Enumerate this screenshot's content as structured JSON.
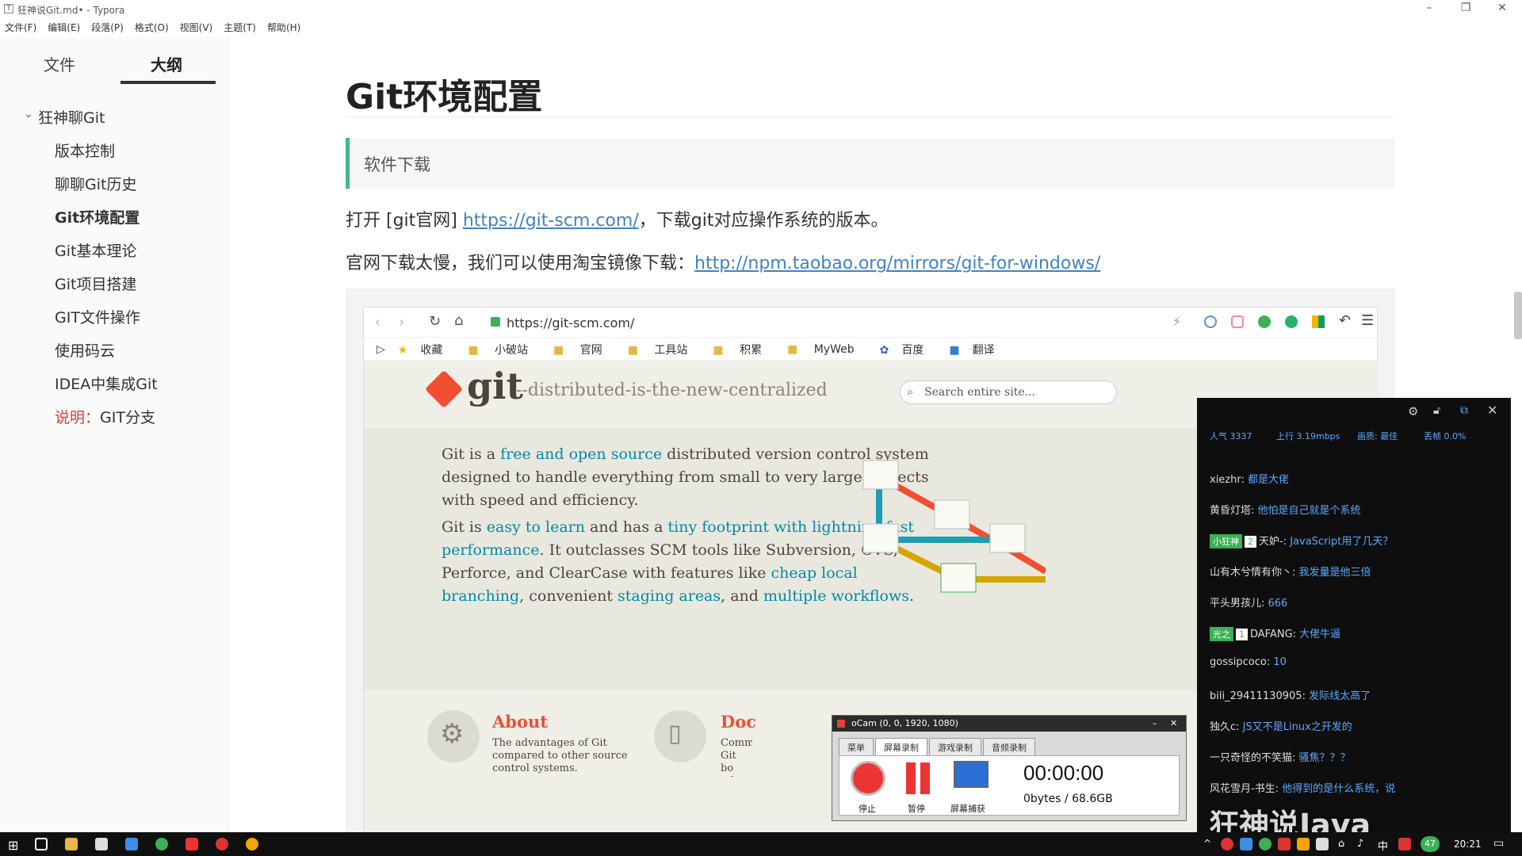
{
  "window": {
    "title": "狂神说Git.md• - Typora",
    "icon": "T"
  },
  "menu": [
    "文件(F)",
    "编辑(E)",
    "段落(P)",
    "格式(O)",
    "视图(V)",
    "主题(T)",
    "帮助(H)"
  ],
  "sidebar": {
    "tabs": [
      "文件",
      "大纲"
    ],
    "root": "狂神聊Git",
    "items": [
      "版本控制",
      "聊聊Git历史",
      "Git环境配置",
      "Git基本理论",
      "Git项目搭建",
      "GIT文件操作",
      "使用码云",
      "IDEA中集成Git"
    ],
    "note_prefix": "说明：",
    "note_label": "GIT分支",
    "footer": [
      "<",
      "</>"
    ]
  },
  "doc": {
    "heading": "Git环境配置",
    "quote": "软件下载",
    "p1_prefix": "打开 [git官网] ",
    "p1_link": "https://git-scm.com/",
    "p1_suffix": "，下载git对应操作系统的版本。",
    "p2_prefix": "官网下载太慢，我们可以使用淘宝镜像下载：",
    "p2_link": "http://npm.taobao.org/mirrors/git-for-windows/"
  },
  "browser": {
    "url": "https://git-scm.com/",
    "bookmarks": [
      "收藏",
      "小破站",
      "官网",
      "工具站",
      "积累",
      "MyWeb",
      "百度",
      "翻译"
    ],
    "git": {
      "logo": "git",
      "tagline": "--distributed-is-the-new-centralized",
      "search_placeholder": "Search entire site...",
      "para1_a": "Git is a ",
      "para1_link": "free and open source",
      "para1_b": " distributed version control system designed to handle everything from small to very large projects with speed and efficiency.",
      "para2_a": "Git is ",
      "para2_link1": "easy to learn",
      "para2_b": " and has a ",
      "para2_link2": "tiny footprint with lightning fast performance",
      "para2_c": ". It outclasses SCM tools like Subversion, CVS, Perforce, and ClearCase with features like ",
      "para2_link3": "cheap local branching",
      "para2_d": ", convenient ",
      "para2_link4": "staging areas",
      "para2_e": ", and ",
      "para2_link5": "multiple workflows",
      "para2_f": ".",
      "about_title": "About",
      "about_text": "The advantages of Git compared to other source control systems.",
      "doc_title": "Doc",
      "doc_text": "Comm Git bo other"
    }
  },
  "live": {
    "stats": {
      "popularity": "人气  3337",
      "upload": "上行  3.19mbps",
      "quality": "画质: 最佳",
      "drop": "丢帧 0.0%"
    },
    "messages": [
      {
        "user": "xiezhr: ",
        "msg": "都是大佬"
      },
      {
        "user": "黄昏灯塔: ",
        "msg": "他怕是自己就是个系统"
      },
      {
        "badge": "小狂神",
        "level": "2",
        "user": "天妒-: ",
        "msg": "JavaScript用了几天？"
      },
      {
        "user": "山有木兮情有你丶: ",
        "msg": "我发量是他三倍"
      },
      {
        "user": "平头男孩儿: ",
        "msg": "666"
      },
      {
        "badge": "光之",
        "level": "1",
        "user": "DAFANG: ",
        "msg": "大佬牛逼"
      },
      {
        "user": "gossipcoco: ",
        "msg": "10"
      },
      {
        "user": "bili_29411130905: ",
        "msg": "发际线太高了"
      },
      {
        "user": "独久c: ",
        "msg": "JS又不是Linux之开发的"
      },
      {
        "user": "一只奇怪的不笑猫: ",
        "msg": "骚焦？？？"
      },
      {
        "user": "风花雪月-书生: ",
        "msg": "他得到的是什么系统，说"
      }
    ]
  },
  "ocam": {
    "title": "oCam (0, 0, 1920, 1080)",
    "tabs": [
      "菜单",
      "屏幕录制",
      "游戏录制",
      "音频录制"
    ],
    "buttons": [
      "停止",
      "暂停",
      "屏幕捕获"
    ],
    "timer": "00:00:00",
    "size": "0bytes / 68.6GB"
  },
  "watermark": "狂神说Java",
  "taskbar": {
    "time": "20:21",
    "ime": "中",
    "badge": "47"
  }
}
